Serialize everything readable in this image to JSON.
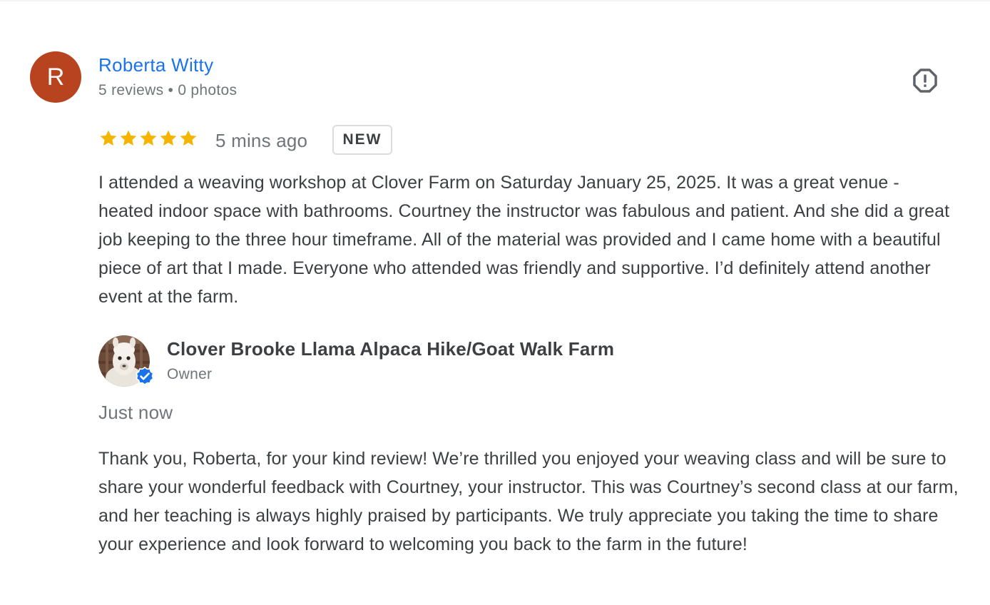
{
  "review": {
    "reviewer": {
      "initial": "R",
      "avatar_color": "#b8431f",
      "name": "Roberta Witty",
      "meta": "5 reviews • 0 photos"
    },
    "report_icon": "report-flag-icon",
    "rating": 5,
    "rating_max": 5,
    "star_color": "#f4b400",
    "time_ago": "5 mins ago",
    "badge": "NEW",
    "text": "I attended a weaving workshop at Clover Farm on Saturday January 25, 2025. It was a great venue - heated indoor space with bathrooms. Courtney the instructor was fabulous and patient. And she did a great job keeping to the three hour timeframe. All of the material was provided and I came home with a beautiful piece of art that I made. Everyone who attended was friendly and supportive. I’d definitely attend another event at the farm."
  },
  "owner_response": {
    "owner_name": "Clover Brooke Llama Alpaca Hike/Goat Walk Farm",
    "owner_role": "Owner",
    "verified_icon": "verified-check-icon",
    "time": "Just now",
    "text": "Thank you, Roberta, for your kind review! We’re thrilled you enjoyed your weaving class and will be sure to share your wonderful feedback with Courtney, your instructor. This was Courtney’s second class at our farm, and her teaching is always highly praised by participants. We truly appreciate you taking the time to share your experience and look forward to welcoming you back to the farm in the future!"
  },
  "colors": {
    "link_blue": "#1a73e8",
    "muted_text": "#70757a",
    "body_text": "#3c4043",
    "verified_blue": "#1a73e8"
  }
}
